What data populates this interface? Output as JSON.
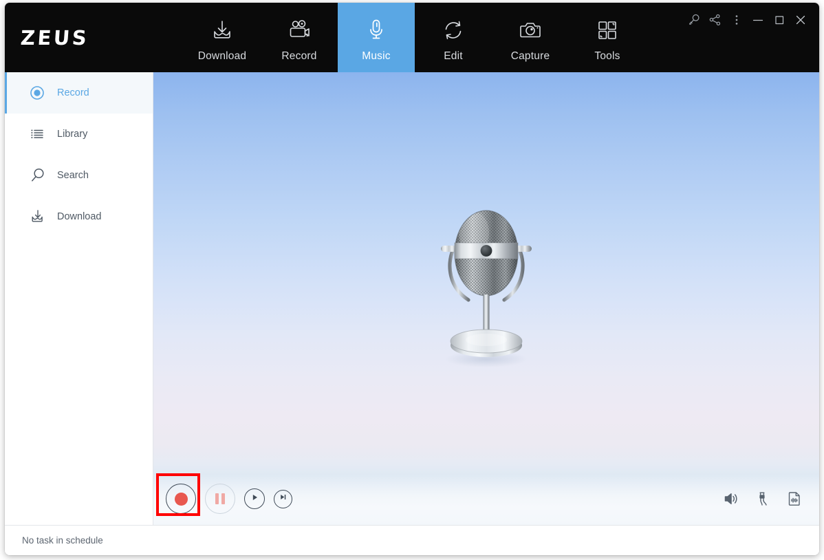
{
  "app": {
    "logo_text": "ZEUS"
  },
  "header": {
    "tabs": [
      {
        "label": "Download",
        "icon": "download-tray-icon",
        "active": false
      },
      {
        "label": "Record",
        "icon": "video-camera-icon",
        "active": false
      },
      {
        "label": "Music",
        "icon": "microphone-icon",
        "active": true
      },
      {
        "label": "Edit",
        "icon": "refresh-circle-icon",
        "active": false
      },
      {
        "label": "Capture",
        "icon": "camera-icon",
        "active": false
      },
      {
        "label": "Tools",
        "icon": "grid-squares-icon",
        "active": false
      }
    ],
    "window_controls": [
      {
        "name": "key-icon",
        "glyph": "key"
      },
      {
        "name": "share-icon",
        "glyph": "share"
      },
      {
        "name": "more-menu-icon",
        "glyph": "dots"
      },
      {
        "name": "minimize-icon",
        "glyph": "minimize"
      },
      {
        "name": "maximize-icon",
        "glyph": "maximize"
      },
      {
        "name": "close-icon",
        "glyph": "close"
      }
    ]
  },
  "sidebar": {
    "items": [
      {
        "label": "Record",
        "icon": "record-circle-icon",
        "active": true
      },
      {
        "label": "Library",
        "icon": "list-icon",
        "active": false
      },
      {
        "label": "Search",
        "icon": "magnifier-icon",
        "active": false
      },
      {
        "label": "Download",
        "icon": "download-tray-icon",
        "active": false
      }
    ]
  },
  "content": {
    "illustration": "vintage-microphone-illustration"
  },
  "controls": {
    "record_label": "Record",
    "pause_label": "Pause",
    "play_label": "Play",
    "next_label": "Next",
    "record_highlighted": true,
    "tools": [
      {
        "label": "Volume",
        "icon": "speaker-icon"
      },
      {
        "label": "Audio Input",
        "icon": "audio-jack-icon"
      },
      {
        "label": "Audio Format",
        "icon": "audio-file-icon"
      }
    ]
  },
  "status": {
    "text": "No task in schedule"
  },
  "colors": {
    "accent": "#5aa7e4",
    "header_bg": "#0a0a0a",
    "record_red": "#e8584f",
    "highlight_red": "#ff0000"
  }
}
